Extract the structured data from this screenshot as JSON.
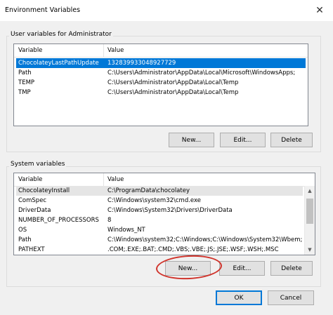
{
  "window": {
    "title": "Environment Variables"
  },
  "user_vars": {
    "label": "User variables for Administrator",
    "columns": [
      "Variable",
      "Value"
    ],
    "rows": [
      {
        "name": "ChocolateyLastPathUpdate",
        "value": "132839933048927729"
      },
      {
        "name": "Path",
        "value": "C:\\Users\\Administrator\\AppData\\Local\\Microsoft\\WindowsApps;"
      },
      {
        "name": "TEMP",
        "value": "C:\\Users\\Administrator\\AppData\\Local\\Temp"
      },
      {
        "name": "TMP",
        "value": "C:\\Users\\Administrator\\AppData\\Local\\Temp"
      }
    ],
    "buttons": {
      "new": "New...",
      "edit": "Edit...",
      "delete": "Delete"
    }
  },
  "system_vars": {
    "label": "System variables",
    "columns": [
      "Variable",
      "Value"
    ],
    "rows": [
      {
        "name": "ChocolateyInstall",
        "value": "C:\\ProgramData\\chocolatey"
      },
      {
        "name": "ComSpec",
        "value": "C:\\Windows\\system32\\cmd.exe"
      },
      {
        "name": "DriverData",
        "value": "C:\\Windows\\System32\\Drivers\\DriverData"
      },
      {
        "name": "NUMBER_OF_PROCESSORS",
        "value": "8"
      },
      {
        "name": "OS",
        "value": "Windows_NT"
      },
      {
        "name": "Path",
        "value": "C:\\Windows\\system32;C:\\Windows;C:\\Windows\\System32\\Wbem;..."
      },
      {
        "name": "PATHEXT",
        "value": ".COM;.EXE;.BAT;.CMD;.VBS;.VBE;.JS;.JSE;.WSF;.WSH;.MSC"
      }
    ],
    "buttons": {
      "new": "New...",
      "edit": "Edit...",
      "delete": "Delete"
    }
  },
  "footer": {
    "ok": "OK",
    "cancel": "Cancel"
  },
  "colors": {
    "selection": "#0078d7",
    "annotation": "#d0342c"
  },
  "icons": {
    "close": "close-icon",
    "scroll_up": "chevron-up-icon",
    "scroll_down": "chevron-down-icon"
  }
}
